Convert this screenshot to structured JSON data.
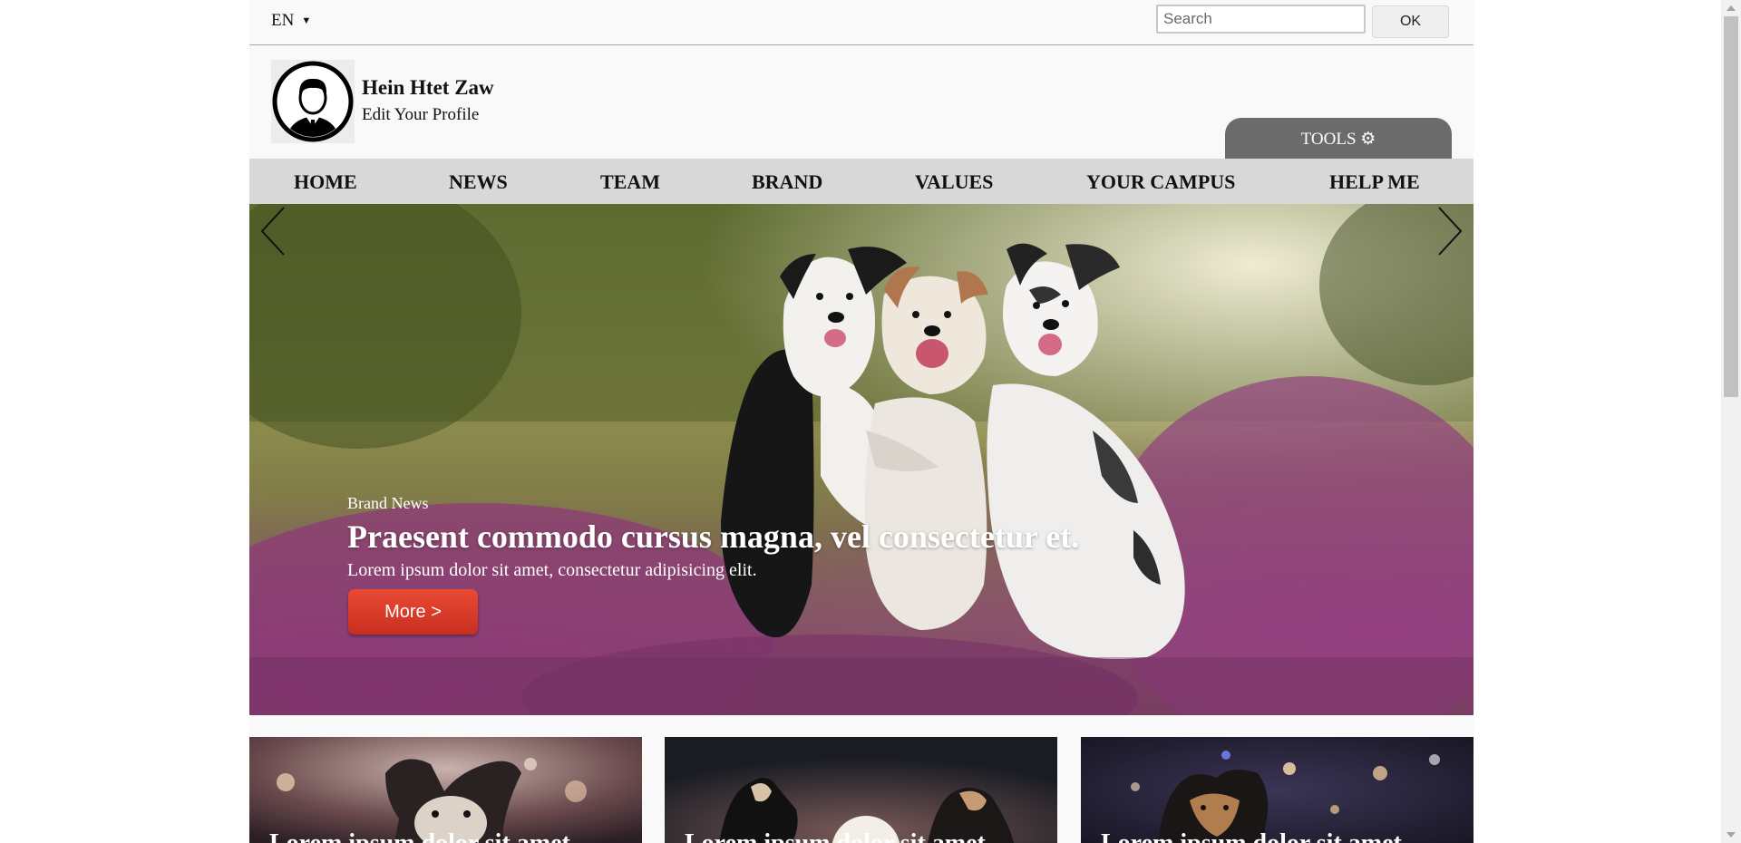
{
  "topbar": {
    "language": "EN",
    "search_placeholder": "Search",
    "ok_label": "OK"
  },
  "profile": {
    "name": "Hein Htet Zaw",
    "edit_label": "Edit Your Profile",
    "tools_label": "TOOLS ⚙"
  },
  "nav": {
    "items": [
      "HOME",
      "NEWS",
      "TEAM",
      "BRAND",
      "VALUES",
      "YOUR CAMPUS",
      "HELP ME"
    ]
  },
  "hero": {
    "kicker": "Brand News",
    "title": "Praesent commodo cursus magna, vel consectetur et.",
    "subtitle": "Lorem ipsum dolor sit amet, consectetur adipisicing elit.",
    "more_label": "More >"
  },
  "cards": [
    {
      "title": "Lorem ipsum dolor sit amet"
    },
    {
      "title": "Lorem ipsum dolor sit amet"
    },
    {
      "title": "Lorem ipsum dolor sit amet"
    }
  ],
  "icons": {
    "caret": "caret-down-icon",
    "gear": "gear-icon",
    "prev": "chevron-left-icon",
    "next": "chevron-right-icon",
    "avatar": "user-avatar-icon"
  },
  "colors": {
    "nav_bg": "#d8d8d8",
    "tools_bg": "#6b6b6b",
    "more_button": "#d93a28"
  }
}
